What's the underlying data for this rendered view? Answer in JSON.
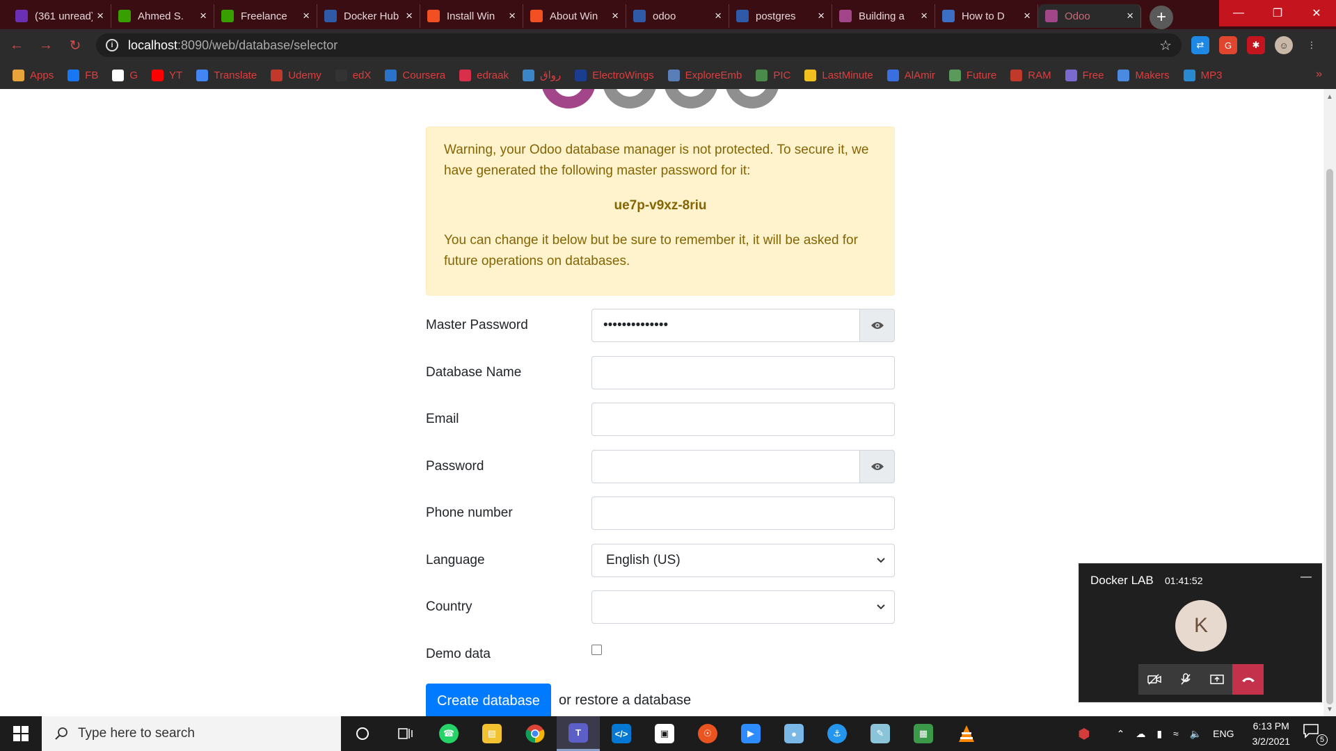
{
  "browser": {
    "tabs": [
      {
        "label": "(361 unread)",
        "icon": "mail-icon",
        "color": "#6b2fb3",
        "active": false
      },
      {
        "label": "Ahmed S.",
        "icon": "upwork-icon",
        "color": "#37a000",
        "active": false
      },
      {
        "label": "Freelance",
        "icon": "upwork-icon",
        "color": "#37a000",
        "active": false
      },
      {
        "label": "Docker Hub",
        "icon": "docker-icon",
        "color": "#2f5aa8",
        "active": false
      },
      {
        "label": "Install Win",
        "icon": "windows-icon",
        "color": "#f25022",
        "active": false
      },
      {
        "label": "About Win",
        "icon": "windows-icon",
        "color": "#f25022",
        "active": false
      },
      {
        "label": "odoo",
        "icon": "docker-icon",
        "color": "#2f5aa8",
        "active": false
      },
      {
        "label": "postgres",
        "icon": "docker-icon",
        "color": "#2f5aa8",
        "active": false
      },
      {
        "label": "Building a",
        "icon": "odoo-icon",
        "color": "#a24689",
        "active": false
      },
      {
        "label": "How to D",
        "icon": "globe-icon",
        "color": "#3b6fc4",
        "active": false
      },
      {
        "label": "Odoo",
        "icon": "odoo-icon",
        "color": "#a24689",
        "active": true
      }
    ],
    "url_host": "localhost",
    "url_path": ":8090/web/database/selector",
    "bookmarks": [
      {
        "label": "Apps",
        "color": "#e8a33b"
      },
      {
        "label": "FB",
        "color": "#1877f2"
      },
      {
        "label": "G",
        "color": "#ffffff"
      },
      {
        "label": "YT",
        "color": "#ff0000"
      },
      {
        "label": "Translate",
        "color": "#4285f4"
      },
      {
        "label": "Udemy",
        "color": "#c0392b"
      },
      {
        "label": "edX",
        "color": "#333333"
      },
      {
        "label": "Coursera",
        "color": "#2a73cc"
      },
      {
        "label": "edraak",
        "color": "#d8304a"
      },
      {
        "label": "رواق",
        "color": "#3a86c8"
      },
      {
        "label": "ElectroWings",
        "color": "#1a3d8f"
      },
      {
        "label": "ExploreEmb",
        "color": "#5a7fb8"
      },
      {
        "label": "PIC",
        "color": "#4a8a4a"
      },
      {
        "label": "LastMinute",
        "color": "#f0c020"
      },
      {
        "label": "AlAmir",
        "color": "#3a6fe0"
      },
      {
        "label": "Future",
        "color": "#5a9a5a"
      },
      {
        "label": "RAM",
        "color": "#c0392b"
      },
      {
        "label": "Free",
        "color": "#7a6ad0"
      },
      {
        "label": "Makers",
        "color": "#4a8ae0"
      },
      {
        "label": "MP3",
        "color": "#2a8ad0"
      }
    ]
  },
  "alert": {
    "line1": "Warning, your Odoo database manager is not protected. To secure it, we have generated the following master password for it:",
    "password": "ue7p-v9xz-8riu",
    "line2": "You can change it below but be sure to remember it, it will be asked for future operations on databases."
  },
  "form": {
    "master_password_label": "Master Password",
    "master_password_value": "••••••••••••••",
    "database_name_label": "Database Name",
    "email_label": "Email",
    "password_label": "Password",
    "phone_label": "Phone number",
    "language_label": "Language",
    "language_value": "English (US)",
    "country_label": "Country",
    "country_value": "",
    "demo_label": "Demo data",
    "create_button": "Create database",
    "restore_text": "or restore a database"
  },
  "teams": {
    "title": "Docker LAB",
    "time": "01:41:52",
    "avatar_initial": "K"
  },
  "taskbar": {
    "search_placeholder": "Type here to search",
    "lang": "ENG",
    "time": "6:13 PM",
    "date": "3/2/2021",
    "notifications": "5"
  }
}
